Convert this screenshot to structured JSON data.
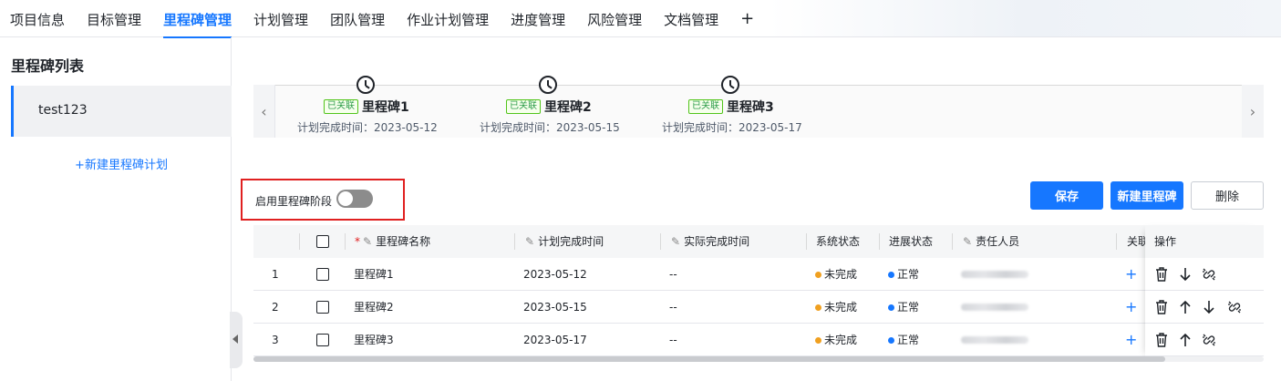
{
  "tabs": [
    {
      "label": "项目信息"
    },
    {
      "label": "目标管理"
    },
    {
      "label": "里程碑管理",
      "active": true
    },
    {
      "label": "计划管理"
    },
    {
      "label": "团队管理"
    },
    {
      "label": "作业计划管理"
    },
    {
      "label": "进度管理"
    },
    {
      "label": "风险管理"
    },
    {
      "label": "文档管理"
    }
  ],
  "tab_add_label": "+",
  "sidebar": {
    "title": "里程碑列表",
    "items": [
      {
        "label": "test123"
      }
    ],
    "new_plan_label": "+新建里程碑计划"
  },
  "timeline": {
    "milestones": [
      {
        "badge": "已关联",
        "name": "里程碑1",
        "date": "计划完成时间：2023-05-12"
      },
      {
        "badge": "已关联",
        "name": "里程碑2",
        "date": "计划完成时间：2023-05-15"
      },
      {
        "badge": "已关联",
        "name": "里程碑3",
        "date": "计划完成时间：2023-05-17"
      }
    ],
    "prev_label": "‹",
    "next_label": "›"
  },
  "stage_toggle": {
    "label": "启用里程碑阶段",
    "enabled": false
  },
  "toolbar": {
    "save_label": "保存",
    "new_label": "新建里程碑",
    "delete_label": "删除"
  },
  "table": {
    "headers": {
      "required_mark": "*",
      "name": "里程碑名称",
      "planned": "计划完成时间",
      "actual": "实际完成时间",
      "system_status": "系统状态",
      "progress_status": "进展状态",
      "owner": "责任人员",
      "related": "关联",
      "ops": "操作"
    },
    "rows": [
      {
        "index": "1",
        "name": "里程碑1",
        "planned": "2023-05-12",
        "actual": "--",
        "system_status": "未完成",
        "progress_status": "正常",
        "related": "+"
      },
      {
        "index": "2",
        "name": "里程碑2",
        "planned": "2023-05-15",
        "actual": "--",
        "system_status": "未完成",
        "progress_status": "正常",
        "related": "+"
      },
      {
        "index": "3",
        "name": "里程碑3",
        "planned": "2023-05-17",
        "actual": "--",
        "system_status": "未完成",
        "progress_status": "正常",
        "related": "+"
      }
    ]
  },
  "colors": {
    "accent": "#1677ff",
    "status_incomplete": "#f0a020",
    "status_normal": "#1677ff",
    "highlight_box": "#e02020"
  }
}
